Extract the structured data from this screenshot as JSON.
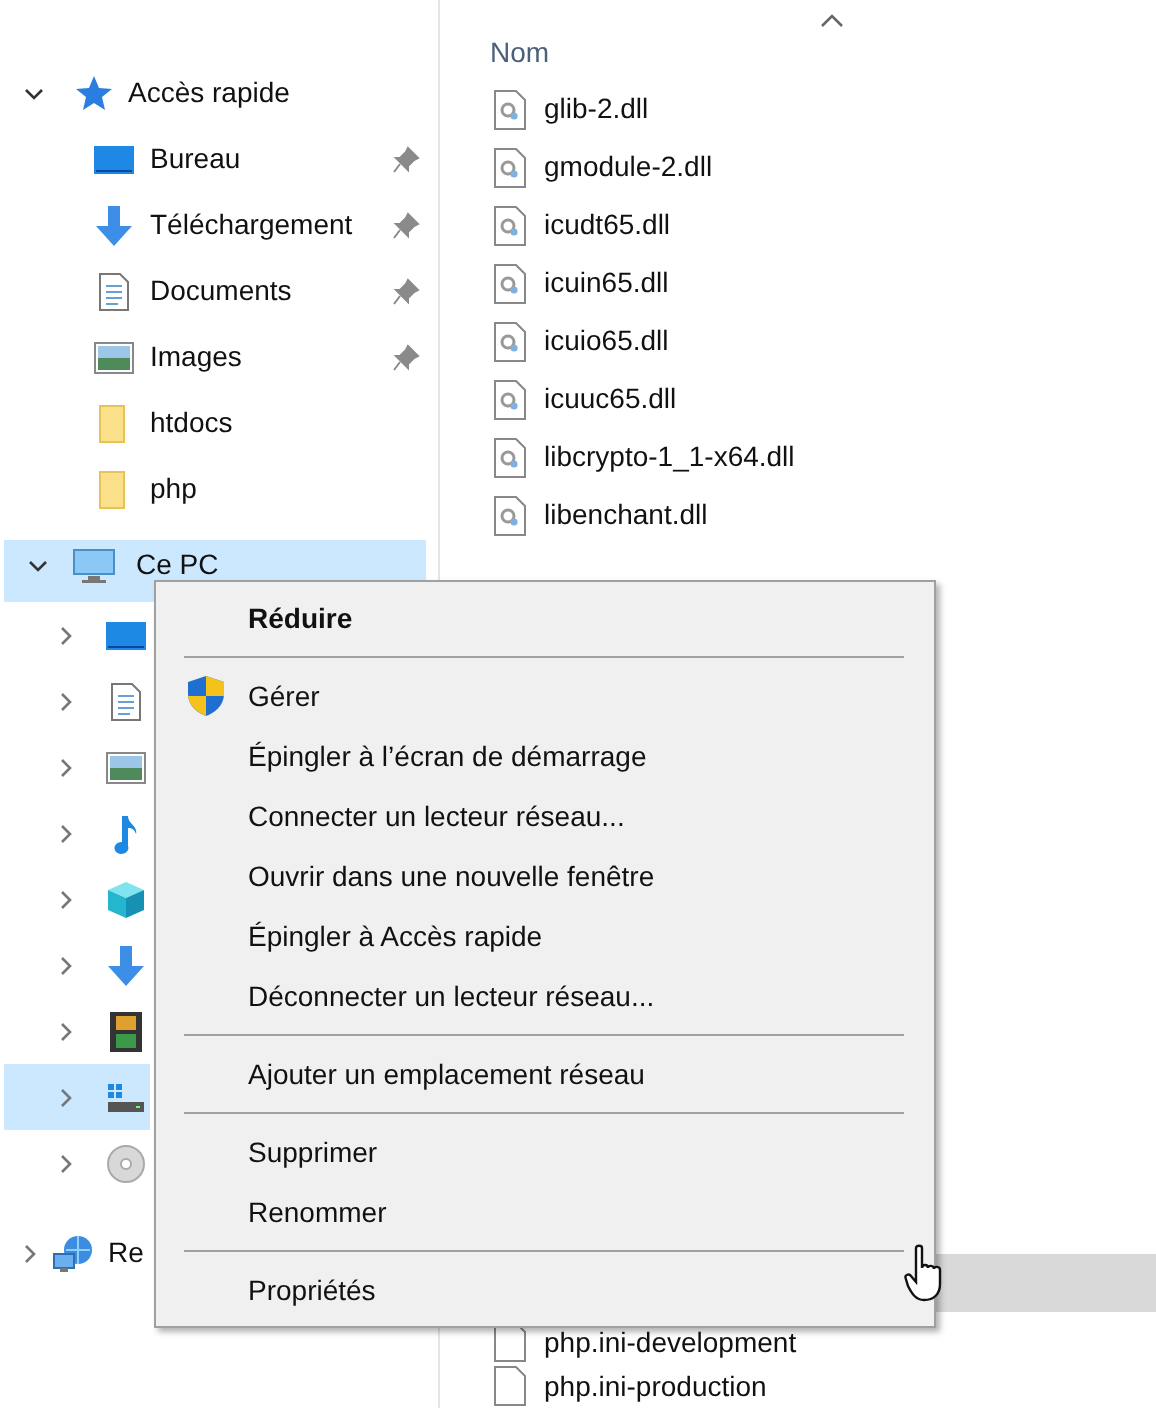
{
  "sidebar": {
    "quick_access": {
      "label": "Accès rapide",
      "expanded": true,
      "items": [
        {
          "label": "Bureau",
          "kind": "desktop",
          "pinned": true
        },
        {
          "label": "Téléchargement",
          "kind": "download",
          "pinned": true
        },
        {
          "label": "Documents",
          "kind": "documents",
          "pinned": true
        },
        {
          "label": "Images",
          "kind": "images",
          "pinned": true
        },
        {
          "label": "htdocs",
          "kind": "folder",
          "pinned": false
        },
        {
          "label": "php",
          "kind": "folder",
          "pinned": false
        }
      ]
    },
    "this_pc": {
      "label": "Ce PC",
      "expanded": true,
      "selected": true,
      "children": [
        {
          "kind": "desktop",
          "selected": false
        },
        {
          "kind": "documents",
          "selected": false
        },
        {
          "kind": "images",
          "selected": false
        },
        {
          "kind": "music",
          "selected": false
        },
        {
          "kind": "cube",
          "selected": false
        },
        {
          "kind": "download",
          "selected": false
        },
        {
          "kind": "video",
          "selected": false
        },
        {
          "kind": "drive",
          "selected": true
        },
        {
          "kind": "disc",
          "selected": false
        }
      ]
    },
    "network": {
      "label": "Re",
      "expanded": false
    }
  },
  "files": {
    "column_header": "Nom",
    "top_rows": [
      {
        "name": "glib-2.dll",
        "kind": "dll"
      },
      {
        "name": "gmodule-2.dll",
        "kind": "dll"
      },
      {
        "name": "icudt65.dll",
        "kind": "dll"
      },
      {
        "name": "icuin65.dll",
        "kind": "dll"
      },
      {
        "name": "icuio65.dll",
        "kind": "dll"
      },
      {
        "name": "icuuc65.dll",
        "kind": "dll"
      },
      {
        "name": "libcrypto-1_1-x64.dll",
        "kind": "dll"
      },
      {
        "name": "libenchant.dll",
        "kind": "dll"
      }
    ],
    "bottom_rows": [
      {
        "name": "php.ini-development",
        "kind": "plain"
      },
      {
        "name": "php.ini-production",
        "kind": "plain"
      }
    ]
  },
  "context_menu": {
    "items": [
      {
        "kind": "default",
        "label": "Réduire"
      },
      {
        "kind": "separator"
      },
      {
        "kind": "admin",
        "label": "Gérer"
      },
      {
        "kind": "item",
        "label": "Épingler à l’écran de démarrage"
      },
      {
        "kind": "item",
        "label": "Connecter un lecteur réseau..."
      },
      {
        "kind": "item",
        "label": "Ouvrir dans une nouvelle fenêtre"
      },
      {
        "kind": "item",
        "label": "Épingler à Accès rapide"
      },
      {
        "kind": "item",
        "label": "Déconnecter un lecteur réseau..."
      },
      {
        "kind": "separator"
      },
      {
        "kind": "item",
        "label": "Ajouter un emplacement réseau"
      },
      {
        "kind": "separator"
      },
      {
        "kind": "item",
        "label": "Supprimer"
      },
      {
        "kind": "item",
        "label": "Renommer"
      },
      {
        "kind": "separator"
      },
      {
        "kind": "item",
        "label": "Propriétés"
      }
    ]
  }
}
